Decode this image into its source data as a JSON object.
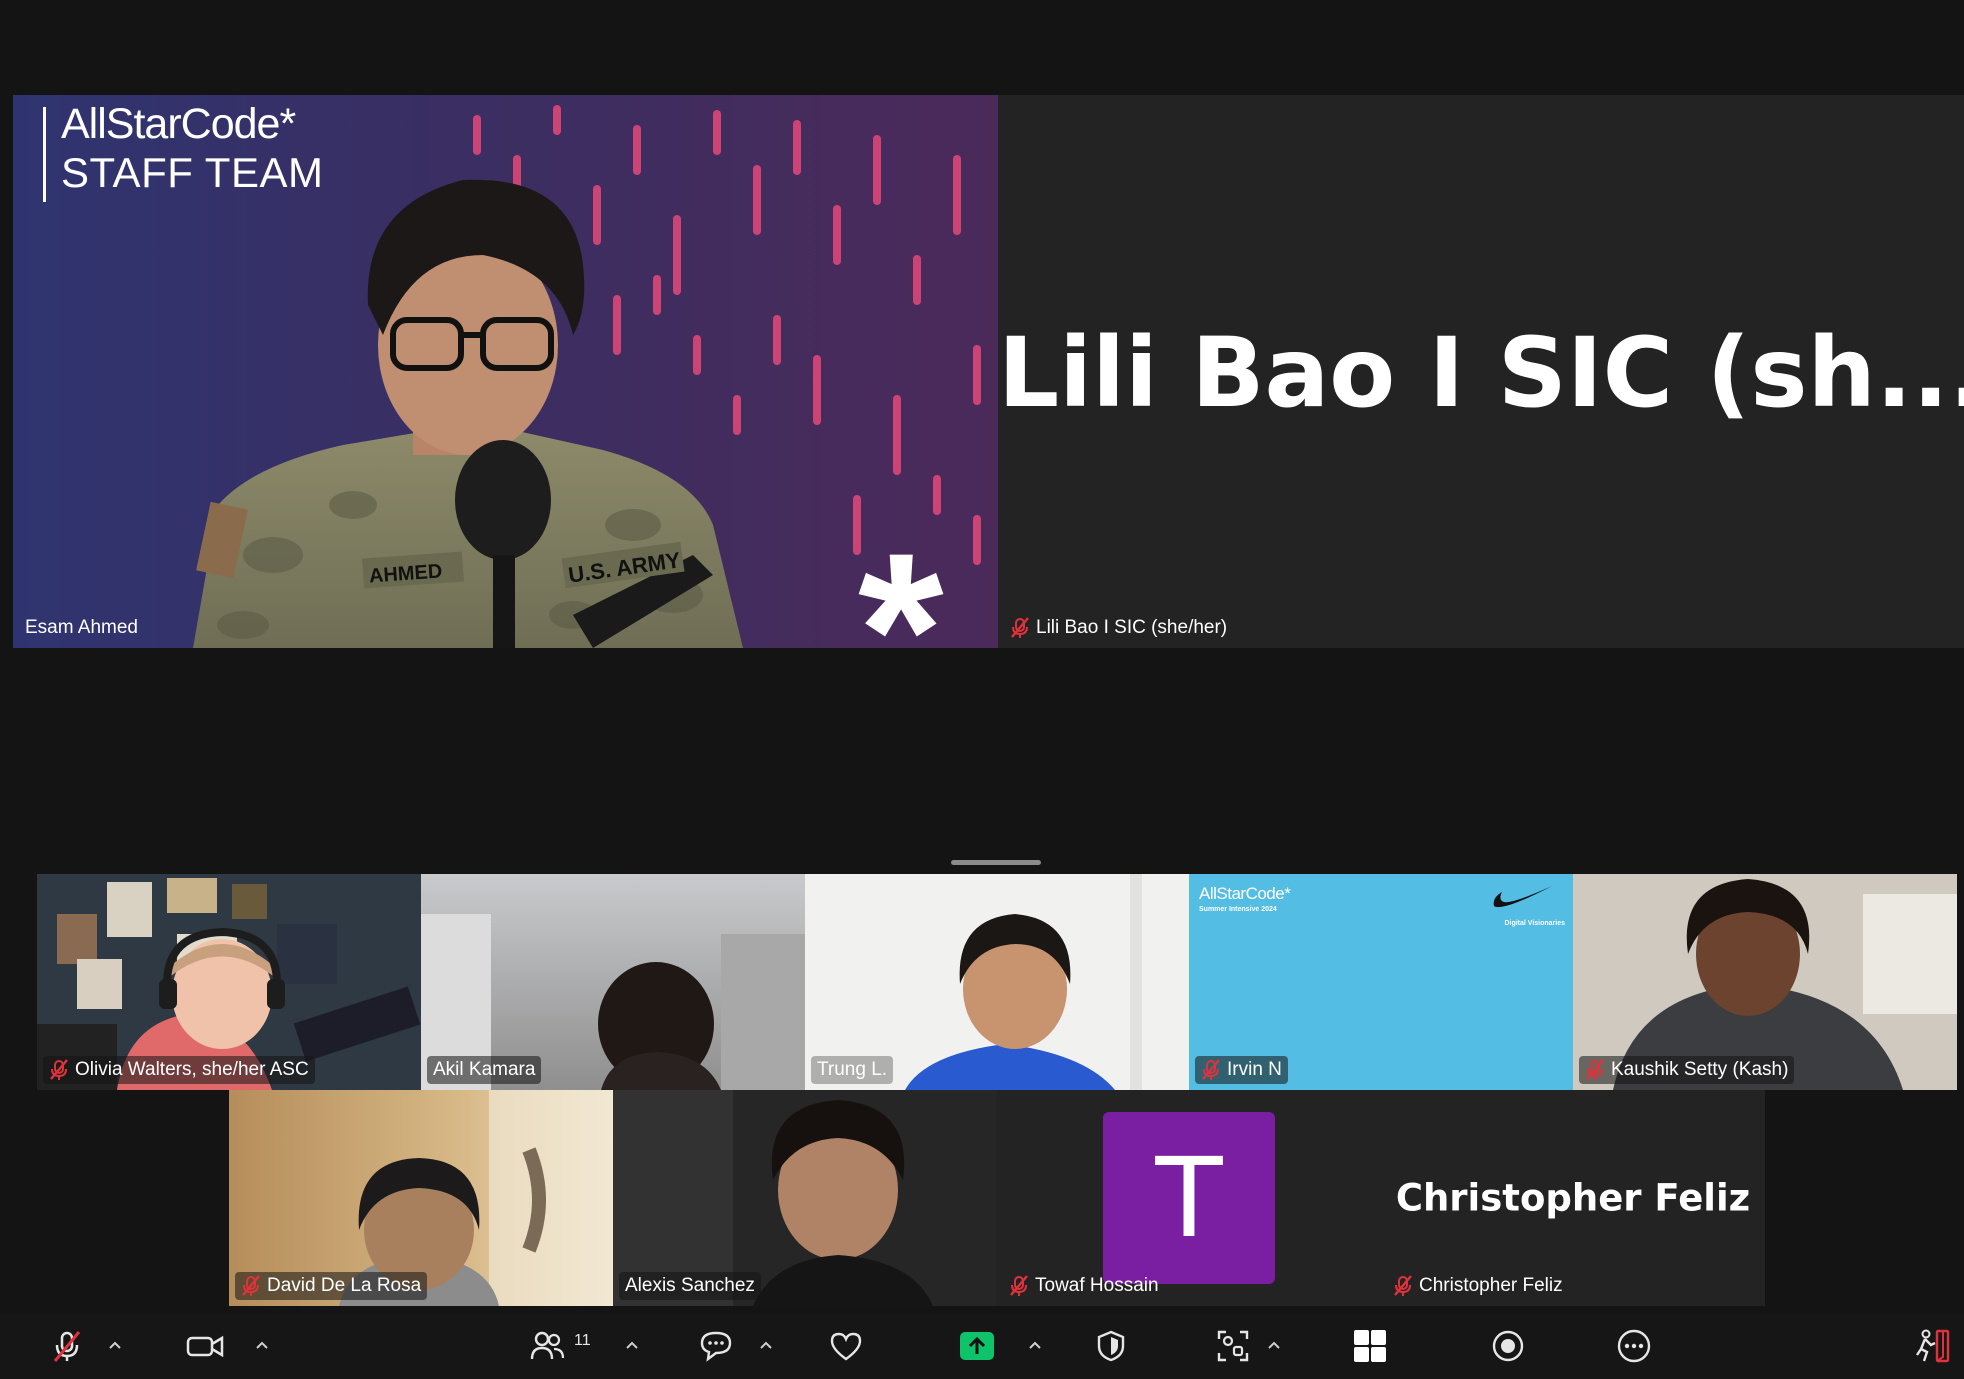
{
  "featured": {
    "presenter": {
      "name": "Esam Ahmed",
      "brand_line1": "AllStarCode*",
      "brand_line2": "STAFF TEAM",
      "badge_left": "AHMED",
      "badge_right": "U.S. ARMY",
      "asterisk": "*"
    },
    "second": {
      "display_name": "Lili Bao I SIC (sh...",
      "name": "Lili Bao I SIC (she/her)",
      "muted": true
    }
  },
  "gallery": {
    "row1": [
      {
        "name": "Olivia Walters, she/her ASC",
        "muted": true
      },
      {
        "name": "Akil Kamara",
        "muted": false
      },
      {
        "name": "Trung L.",
        "muted": false
      },
      {
        "name": "Irvin N",
        "muted": true,
        "brand": "AllStarCode*",
        "subline": "Summer Intensive 2024",
        "partner": "NIKE",
        "partner_sub": "Digital Visionaries"
      },
      {
        "name": "Kaushik Setty (Kash)",
        "muted": true
      }
    ],
    "row2": [
      {
        "name": "David De La Rosa",
        "muted": true
      },
      {
        "name": "Alexis Sanchez",
        "muted": false
      },
      {
        "name": "Towaf Hossain",
        "muted": true,
        "avatar_letter": "T",
        "avatar_color": "#7b1fa2"
      },
      {
        "name": "Christopher Feliz",
        "muted": true,
        "display_name": "Christopher Feliz"
      }
    ]
  },
  "toolbar": {
    "participant_count": "11",
    "icons": [
      "mic-off-icon",
      "video-icon",
      "participants-icon",
      "chat-icon",
      "react-icon",
      "share-screen-icon",
      "security-icon",
      "apps-icon",
      "grid-view-icon",
      "record-icon",
      "more-icon",
      "leave-icon"
    ],
    "accent_green": "#0ec36a",
    "accent_red": "#e0323b"
  }
}
